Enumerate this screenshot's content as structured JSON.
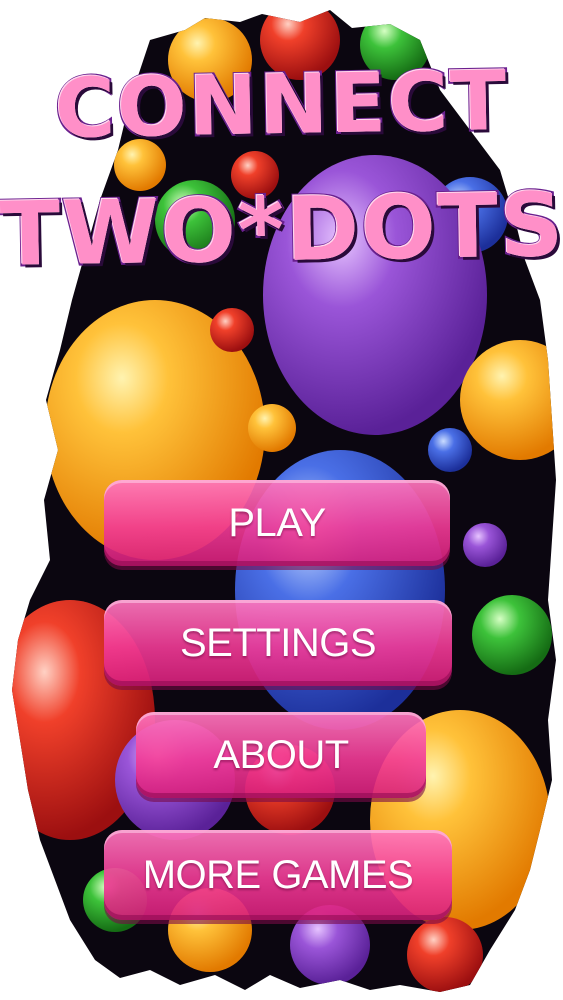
{
  "app": {
    "title_line1": "CONNECT",
    "title_line2": "TWO*DOTS"
  },
  "menu": {
    "play_label": "PLAY",
    "settings_label": "SETTINGS",
    "about_label": "ABOUT",
    "more_games_label": "MORE GAMES"
  },
  "colors": {
    "button_pink": "#f23a96",
    "title_pink": "#ff8fc8",
    "title_outline": "#6a1f8e",
    "background": "#ffffff"
  }
}
